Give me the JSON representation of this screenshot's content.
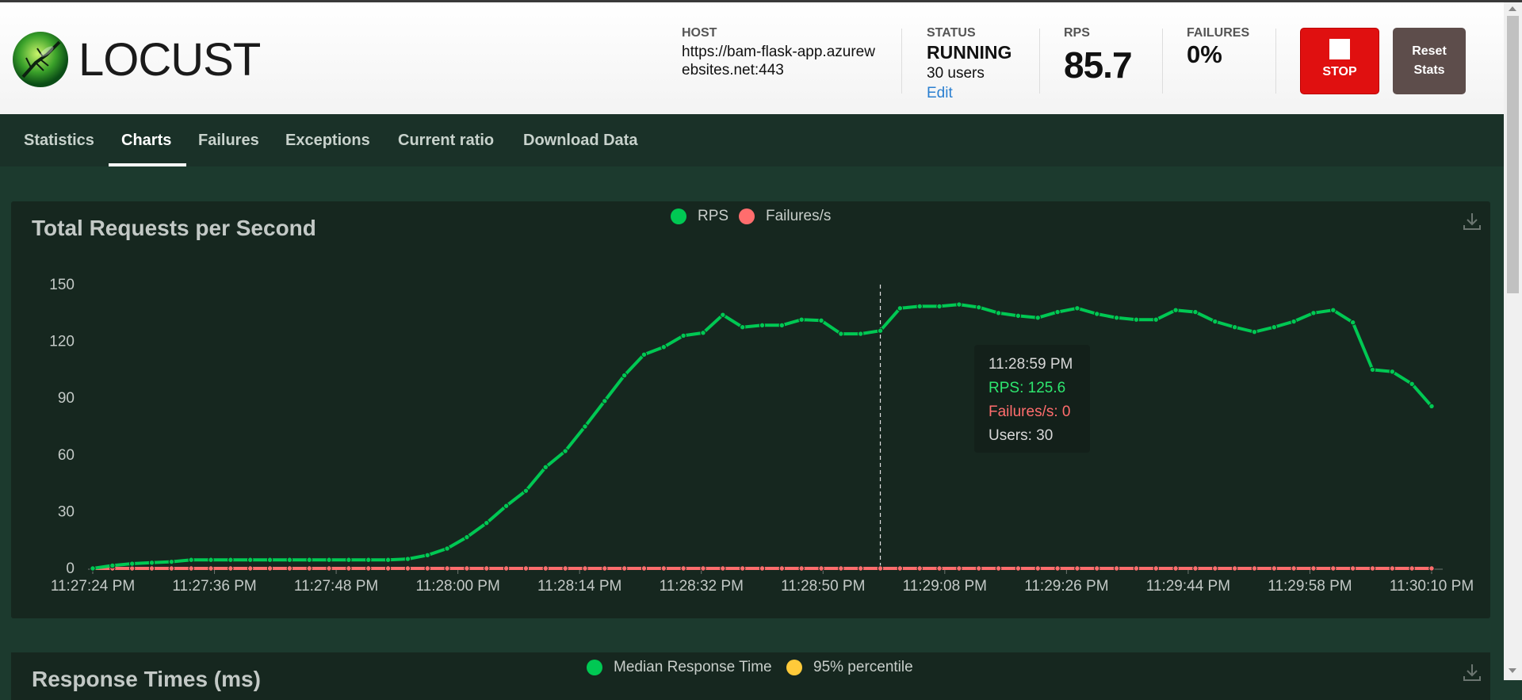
{
  "header": {
    "logo_text": "LOCUST",
    "host_label": "HOST",
    "host_value": "https://bam-flask-app.azurewebsites.net:443",
    "status_label": "STATUS",
    "status_value": "RUNNING",
    "users_value": "30 users",
    "edit_label": "Edit",
    "rps_label": "RPS",
    "rps_value": "85.7",
    "failures_label": "FAILURES",
    "failures_value": "0%",
    "stop_label": "STOP",
    "reset_label": "Reset Stats"
  },
  "tabs": [
    {
      "label": "Statistics"
    },
    {
      "label": "Charts",
      "active": true
    },
    {
      "label": "Failures"
    },
    {
      "label": "Exceptions"
    },
    {
      "label": "Current ratio"
    },
    {
      "label": "Download Data"
    }
  ],
  "panel1": {
    "title": "Total Requests per Second",
    "legend": [
      {
        "label": "RPS",
        "color": "#00c853"
      },
      {
        "label": "Failures/s",
        "color": "#ff6d6d"
      }
    ],
    "tooltip": {
      "time": "11:28:59 PM",
      "rps": "RPS: 125.6",
      "failures": "Failures/s: 0",
      "users": "Users: 30"
    }
  },
  "panel2": {
    "title": "Response Times (ms)",
    "legend": [
      {
        "label": "Median Response Time",
        "color": "#00c853"
      },
      {
        "label": "95% percentile",
        "color": "#ffca3a"
      }
    ]
  },
  "chart_data": {
    "type": "line",
    "title": "Total Requests per Second",
    "ylim": [
      0,
      150
    ],
    "yticks": [
      "0",
      "30",
      "60",
      "90",
      "120",
      "150"
    ],
    "xticks": [
      "11:27:24 PM",
      "11:27:36 PM",
      "11:27:48 PM",
      "11:28:00 PM",
      "11:28:14 PM",
      "11:28:32 PM",
      "11:28:50 PM",
      "11:29:08 PM",
      "11:29:26 PM",
      "11:29:44 PM",
      "11:29:58 PM",
      "11:30:10 PM"
    ],
    "legend_position": "top-center",
    "grid": false,
    "series": [
      {
        "name": "RPS",
        "color": "#00c853",
        "values": [
          0,
          1.5,
          2.5,
          3,
          3.5,
          4.5,
          4.5,
          4.5,
          4.5,
          4.5,
          4.5,
          4.5,
          4.5,
          4.5,
          4.5,
          4.5,
          5,
          7,
          10.5,
          16.5,
          24,
          33,
          41,
          53.5,
          62,
          75,
          88.5,
          102,
          113,
          117,
          123,
          124.5,
          134,
          127.5,
          128.5,
          128.5,
          131.5,
          131,
          124,
          124,
          125.6,
          137.5,
          138.5,
          138.5,
          139.5,
          138,
          135,
          133.5,
          132.5,
          135.5,
          137.5,
          134.5,
          132.5,
          131.5,
          131.5,
          136.5,
          135.5,
          130.5,
          127.5,
          125,
          127.5,
          130.5,
          135,
          136.5,
          130,
          105,
          104,
          97.5,
          85.7
        ]
      },
      {
        "name": "Failures/s",
        "color": "#ff6d6d",
        "values": [
          0,
          0,
          0,
          0,
          0,
          0,
          0,
          0,
          0,
          0,
          0,
          0,
          0,
          0,
          0,
          0,
          0,
          0,
          0,
          0,
          0,
          0,
          0,
          0,
          0,
          0,
          0,
          0,
          0,
          0,
          0,
          0,
          0,
          0,
          0,
          0,
          0,
          0,
          0,
          0,
          0,
          0,
          0,
          0,
          0,
          0,
          0,
          0,
          0,
          0,
          0,
          0,
          0,
          0,
          0,
          0,
          0,
          0,
          0,
          0,
          0,
          0,
          0,
          0,
          0,
          0,
          0,
          0,
          0
        ]
      }
    ],
    "hover_index": 40
  }
}
